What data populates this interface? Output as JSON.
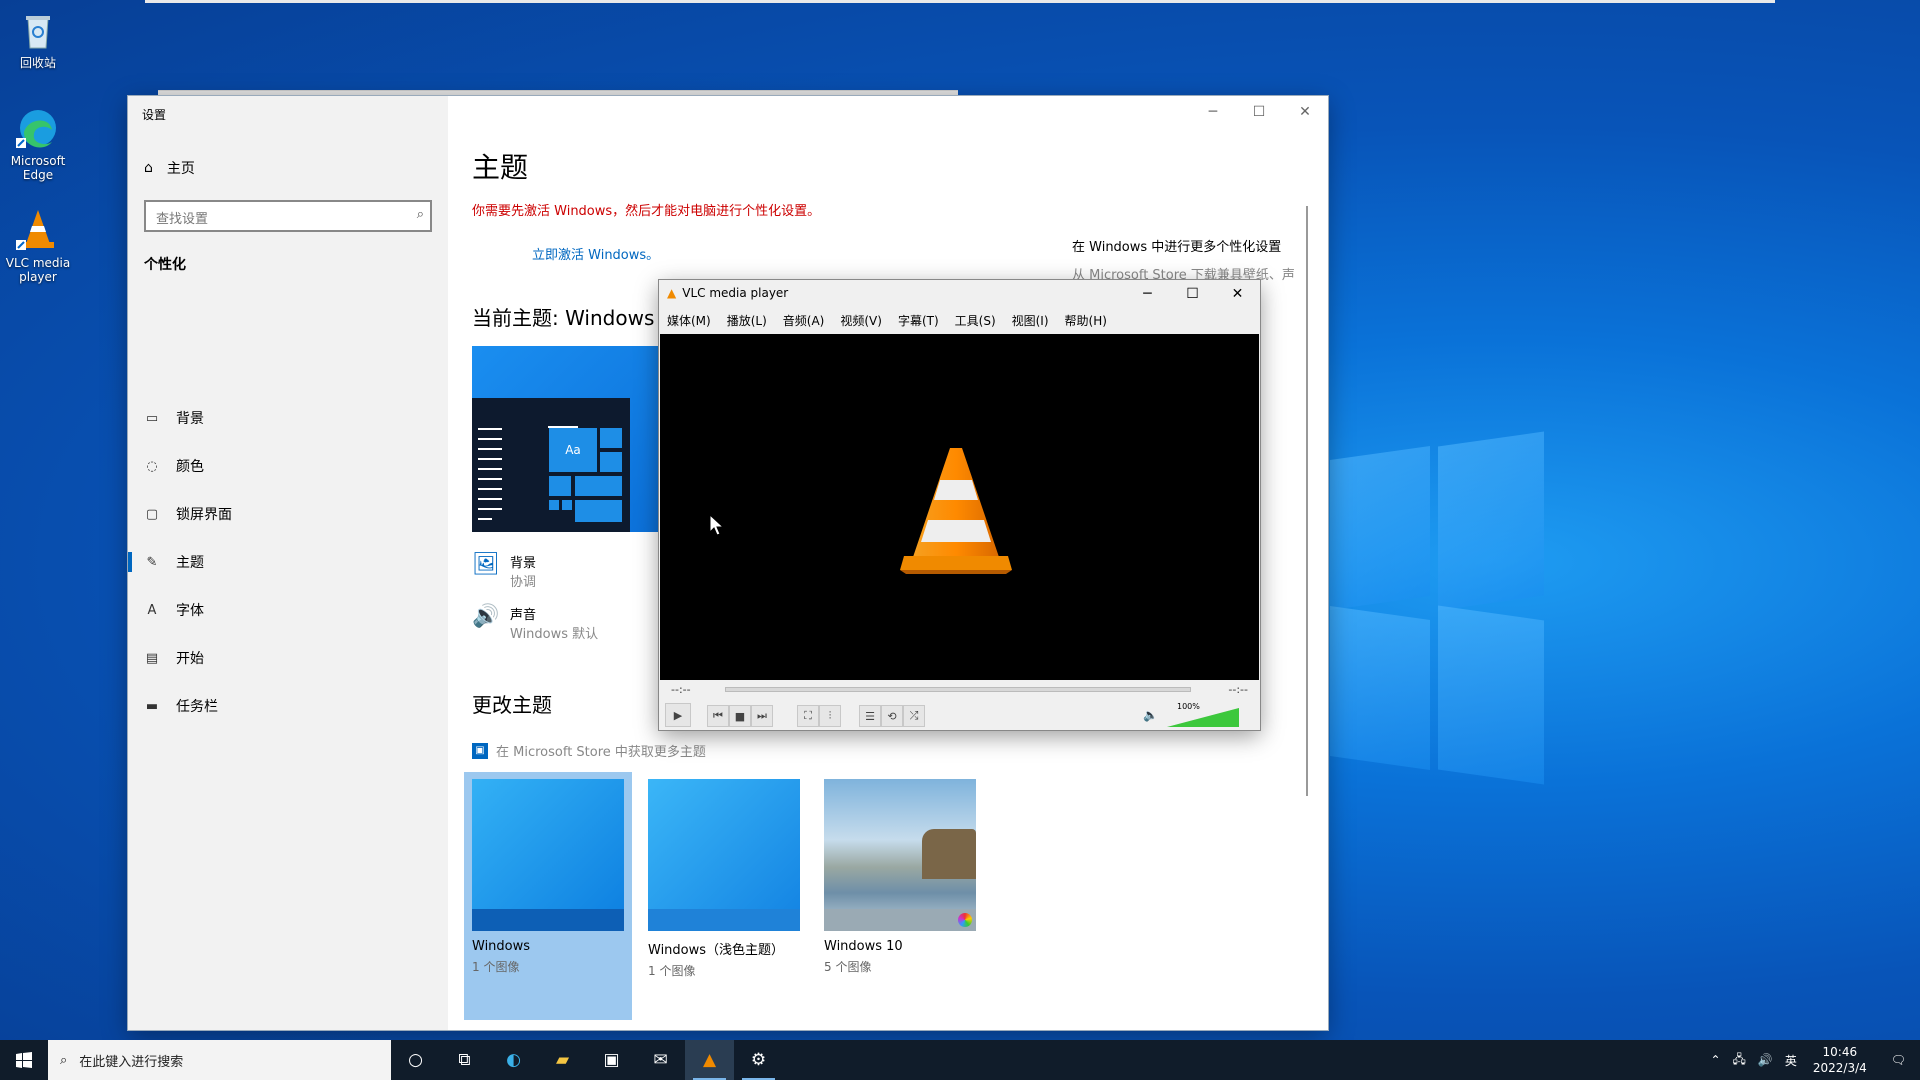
{
  "desktop": {
    "icons": [
      {
        "label": "回收站",
        "icon": "recycle-bin-icon"
      },
      {
        "label": "Microsoft Edge",
        "icon": "edge-icon"
      },
      {
        "label": "VLC media player",
        "icon": "vlc-icon"
      }
    ]
  },
  "settings": {
    "title": "设置",
    "home": "主页",
    "search_placeholder": "查找设置",
    "section": "个性化",
    "nav": [
      {
        "label": "背景",
        "icon": "picture-icon"
      },
      {
        "label": "颜色",
        "icon": "palette-icon"
      },
      {
        "label": "锁屏界面",
        "icon": "lockscreen-icon"
      },
      {
        "label": "主题",
        "icon": "theme-brush-icon"
      },
      {
        "label": "字体",
        "icon": "font-icon"
      },
      {
        "label": "开始",
        "icon": "start-icon"
      },
      {
        "label": "任务栏",
        "icon": "taskbar-icon"
      }
    ],
    "page_title": "主题",
    "activation_warning": "你需要先激活 Windows，然后才能对电脑进行个性化设置。",
    "activate_link": "立即激活 Windows。",
    "side_heading": "在 Windows 中进行更多个性化设置",
    "side_text": "从 Microsoft Store 下载兼具壁纸、声",
    "current_theme": "当前主题: Windows",
    "preview_aa": "Aa",
    "props": [
      {
        "name": "背景",
        "value": "协调"
      },
      {
        "name": "声音",
        "value": "Windows 默认"
      }
    ],
    "change_theme": "更改主题",
    "store_link": "在 Microsoft Store 中获取更多主题",
    "themes": [
      {
        "name": "Windows",
        "count": "1 个图像",
        "selected": true
      },
      {
        "name": "Windows（浅色主题）",
        "count": "1 个图像",
        "selected": false
      },
      {
        "name": "Windows 10",
        "count": "5 个图像",
        "selected": false
      }
    ]
  },
  "vlc": {
    "title": "VLC media player",
    "menu": [
      "媒体(M)",
      "播放(L)",
      "音频(A)",
      "视频(V)",
      "字幕(T)",
      "工具(S)",
      "视图(I)",
      "帮助(H)"
    ],
    "time_left": "--:--",
    "time_right": "--:--",
    "volume": "100%",
    "volume_level": 1.0
  },
  "taskbar": {
    "search_placeholder": "在此键入进行搜索",
    "ime": "英",
    "time": "10:46",
    "date": "2022/3/4"
  }
}
